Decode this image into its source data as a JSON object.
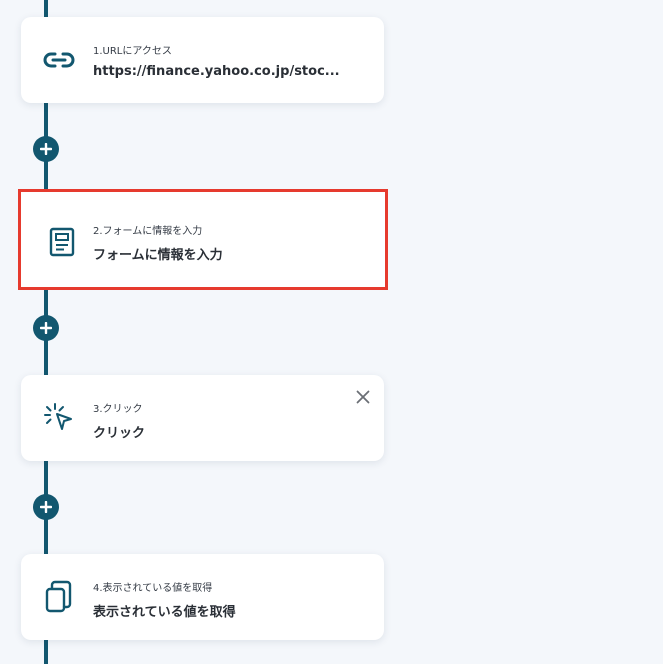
{
  "steps": [
    {
      "label": "1.URLにアクセス",
      "value": "https://finance.yahoo.co.jp/stoc...",
      "icon": "link-icon"
    },
    {
      "label": "2.フォームに情報を入力",
      "value": "フォームに情報を入力",
      "icon": "form-icon"
    },
    {
      "label": "3.クリック",
      "value": "クリック",
      "icon": "cursor-click-icon"
    },
    {
      "label": "4.表示されている値を取得",
      "value": "表示されている値を取得",
      "icon": "copy-icon"
    }
  ],
  "colors": {
    "accent": "#12576f",
    "selected_border": "#e63a2e",
    "background": "#f4f7fb"
  },
  "icons": {
    "add": "plus-icon",
    "close": "close-icon"
  }
}
